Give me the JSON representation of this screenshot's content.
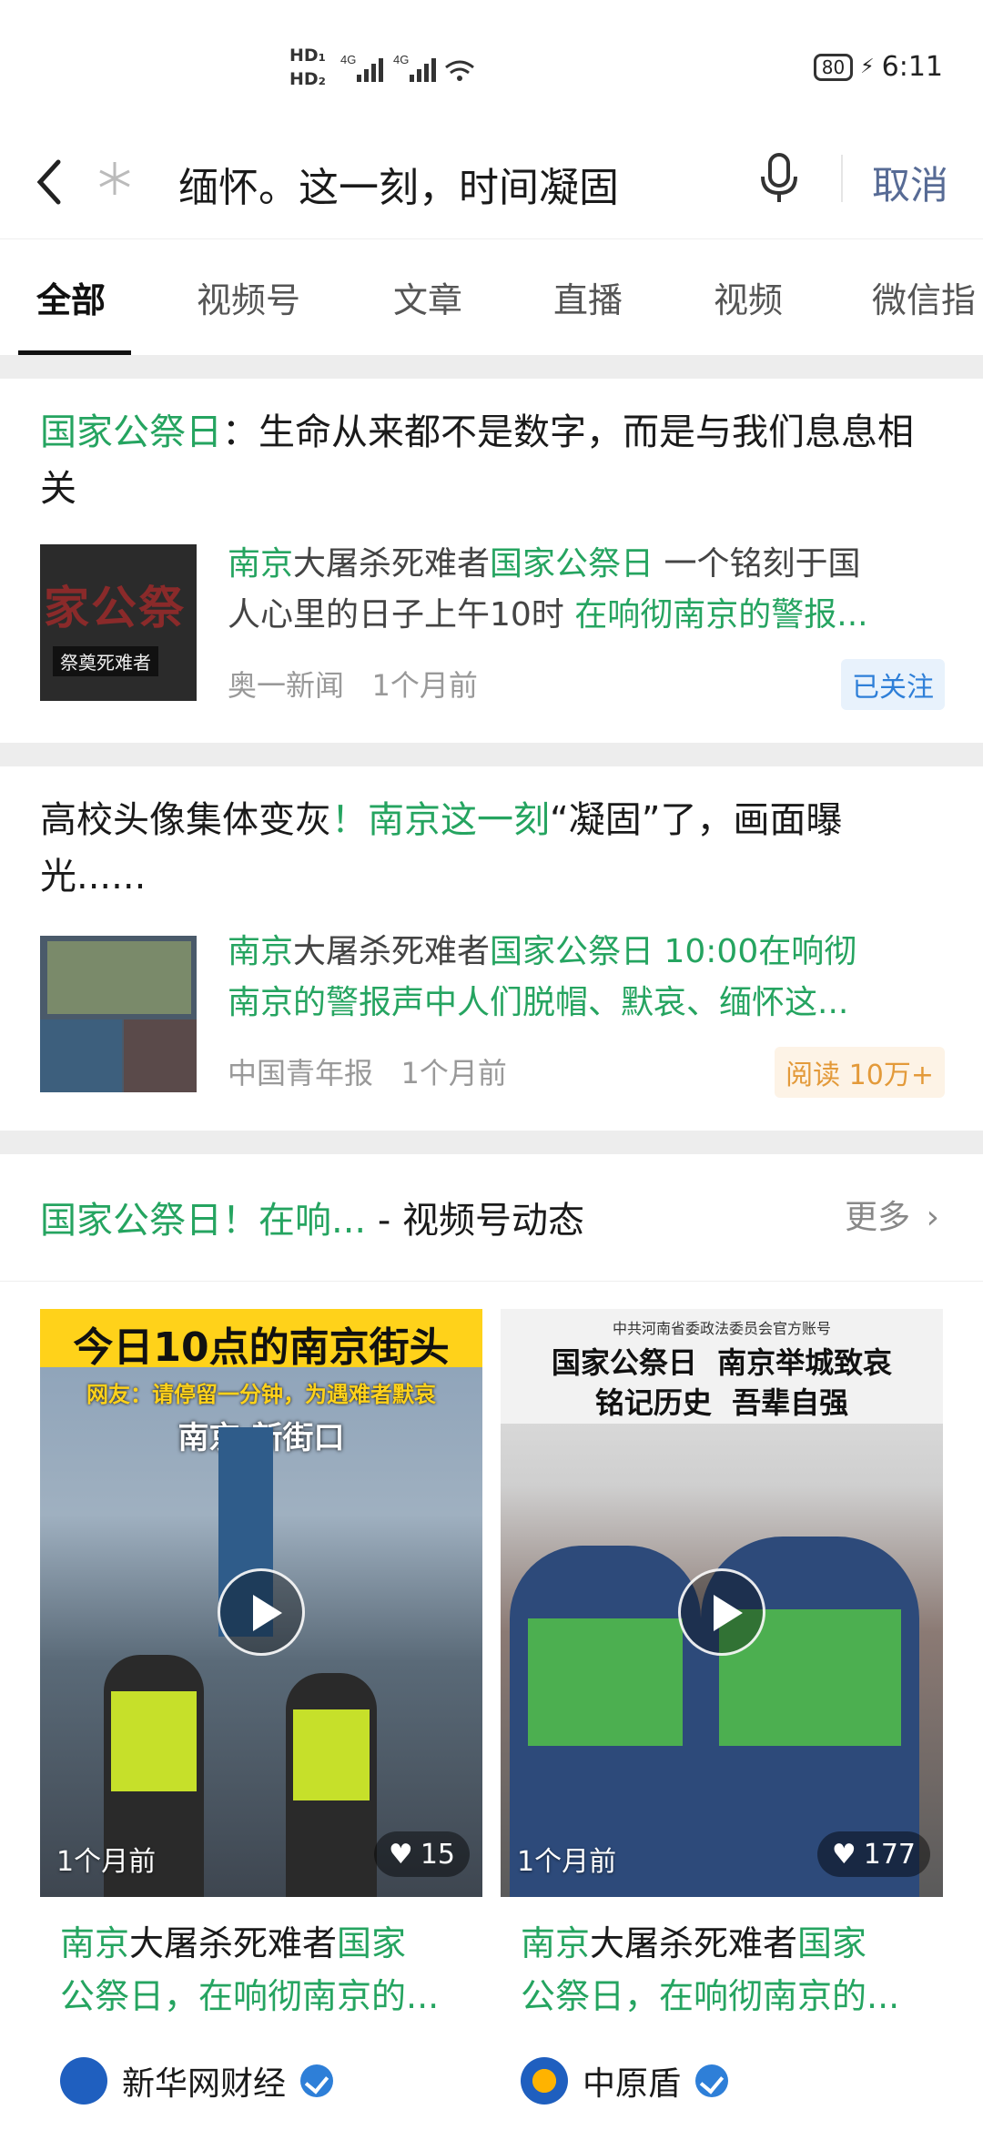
{
  "status_bar": {
    "hd1": "HD₁",
    "hd2": "HD₂",
    "net1": "4G",
    "net2": "4G",
    "battery": "80",
    "time": "6:11"
  },
  "search": {
    "query": "缅怀。这一刻，时间凝固",
    "cancel_label": "取消"
  },
  "tabs": [
    {
      "label": "全部",
      "active": true
    },
    {
      "label": "视频号"
    },
    {
      "label": "文章"
    },
    {
      "label": "直播"
    },
    {
      "label": "视频"
    },
    {
      "label": "微信指"
    }
  ],
  "articles": [
    {
      "title_highlight": "国家公祭日",
      "title_rest": "：生命从来都不是数字，而是与我们息息相关",
      "thumb_text_big": "家公祭",
      "thumb_text_small": "祭奠死难者",
      "desc_line1": {
        "a": "南京",
        "b": "大屠杀死难者",
        "c": "国家公祭日",
        "d": " 一个铭刻于国"
      },
      "desc_line2": {
        "a": "人心里的日子上午10时 ",
        "b": "在响彻南京的警报..."
      },
      "source": "奥一新闻",
      "time": "1个月前",
      "badge": "已关注"
    },
    {
      "title_a": "高校头像集体变灰",
      "title_b": "！南京这一刻",
      "title_c": "“凝固”了，画面曝光......",
      "desc_line1": {
        "a": "南京",
        "b": "大屠杀死难者",
        "c": "国家公祭日",
        "d": " 10:00在响彻"
      },
      "desc_line2": {
        "a": "南京的警报声中人们脱帽、默哀、缅怀这..."
      },
      "source": "中国青年报",
      "time": "1个月前",
      "badge": "阅读 10万+"
    }
  ],
  "video_section": {
    "title_highlight": "国家公祭日！在响...",
    "title_rest": " - 视频号动态",
    "more_label": "更多"
  },
  "videos": [
    {
      "banner": "今日10点的南京街头",
      "subbanner": "网友：请停留一分钟，为遇难者默哀",
      "location": "南京·新街口",
      "time": "1个月前",
      "likes": "15",
      "desc_line1": {
        "a": "南京",
        "b": "大屠杀死难者",
        "c": "国家"
      },
      "desc_line2": {
        "a": "公祭日，在响彻南京的..."
      },
      "author": "新华网财经"
    },
    {
      "banner_top": "中共河南省委政法委员会官方账号",
      "banner_l1": "国家公祭日  南京举城致哀",
      "banner_l2": "铭记历史  吾辈自强",
      "time": "1个月前",
      "likes": "177",
      "desc_line1": {
        "a": "南京",
        "b": "大屠杀死难者",
        "c": "国家"
      },
      "desc_line2": {
        "a": "公祭日，在响彻南京的..."
      },
      "author": "中原盾"
    }
  ],
  "colors": {
    "highlight": "#25a460",
    "link_blue": "#576b95",
    "follow_blue": "#2e7fd8",
    "read_orange": "#e39a3a"
  }
}
